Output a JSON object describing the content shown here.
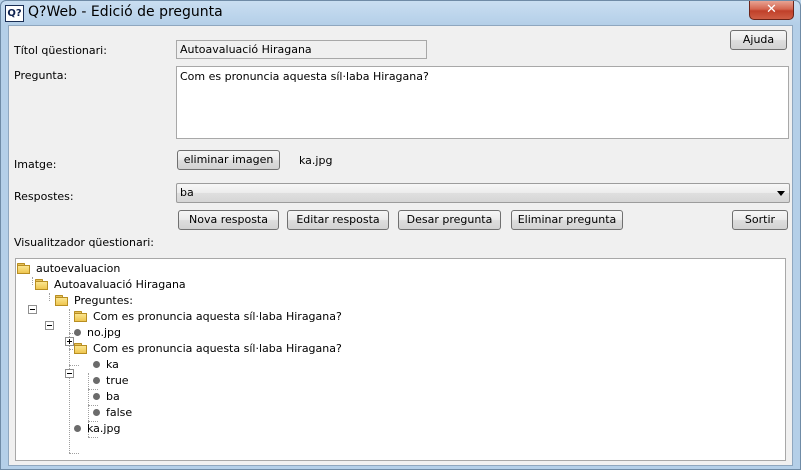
{
  "window": {
    "app_icon": "Q?",
    "title": "Q?Web - Edició de pregunta",
    "close_glyph": "✕"
  },
  "form": {
    "help_button": "Ajuda",
    "questionnaire_title_label": "Títol qüestionari:",
    "questionnaire_title_value": "Autoavaluació Hiragana",
    "question_label": "Pregunta:",
    "question_value": "Com es pronuncia aquesta síl·laba Hiragana?",
    "image_label": "Imatge:",
    "remove_image_button": "eliminar imagen",
    "image_filename": "ka.jpg",
    "answers_label": "Respostes:",
    "answers_selected": "ba",
    "new_answer_button": "Nova resposta",
    "edit_answer_button": "Editar resposta",
    "save_question_button": "Desar pregunta",
    "delete_question_button": "Eliminar pregunta",
    "exit_button": "Sortir",
    "viewer_label": "Visualitzador qüestionari:"
  },
  "tree": {
    "root": "autoevaluacion",
    "questionnaire": "Autoavaluació Hiragana",
    "questions_node": "Preguntes:",
    "question_1": "Com es pronuncia aquesta síl·laba Hiragana?",
    "question_1_image": "no.jpg",
    "question_2": "Com es pronuncia aquesta síl·laba Hiragana?",
    "question_2_items": [
      "ka",
      "true",
      "ba",
      "false"
    ],
    "question_2_image": "ka.jpg"
  }
}
